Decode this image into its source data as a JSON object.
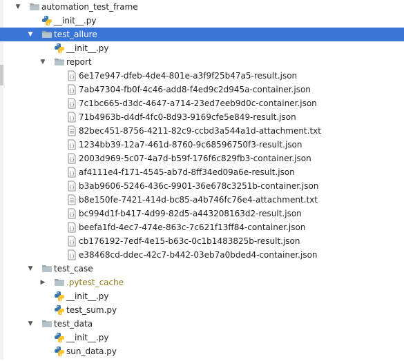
{
  "project_tree": {
    "nodes": [
      {
        "label": "automation_test_frame",
        "type": "folder",
        "level": 0,
        "expanded": true
      },
      {
        "label": "__init__.py",
        "type": "python",
        "level": 1
      },
      {
        "label": "test_allure",
        "type": "folder",
        "level": 1,
        "expanded": true,
        "selected": true
      },
      {
        "label": "__init__.py",
        "type": "python",
        "level": 2
      },
      {
        "label": "report",
        "type": "folder",
        "level": 2,
        "expanded": true
      },
      {
        "label": "6e17e947-dfeb-4de4-801e-a3f9f25b47a5-result.json",
        "type": "json",
        "level": 3
      },
      {
        "label": "7ab47304-fb0f-4c46-add8-f4ed9c2d945a-container.json",
        "type": "json",
        "level": 3
      },
      {
        "label": "7c1bc665-d3dc-4647-a714-23ed7eeb9d0c-container.json",
        "type": "json",
        "level": 3
      },
      {
        "label": "71b4963b-d4df-4fc0-8d93-9169cfe5e849-result.json",
        "type": "json",
        "level": 3
      },
      {
        "label": "82bec451-8756-4211-82c9-ccbd3a544a1d-attachment.txt",
        "type": "text",
        "level": 3
      },
      {
        "label": "1234bb39-12a7-461d-8760-9c68596750f3-result.json",
        "type": "json",
        "level": 3
      },
      {
        "label": "2003d969-5c07-4a7d-b59f-176f6c829fb3-container.json",
        "type": "json",
        "level": 3
      },
      {
        "label": "af4111e4-f171-4545-ab7d-8ff34ed09a6e-result.json",
        "type": "json",
        "level": 3
      },
      {
        "label": "b3ab9606-5246-436c-9901-36e678c3251b-container.json",
        "type": "json",
        "level": 3
      },
      {
        "label": "b8e150fe-7421-414d-bc85-a4b746fc76e4-attachment.txt",
        "type": "text",
        "level": 3
      },
      {
        "label": "bc994d1f-b417-4d99-82d5-a443208163d2-result.json",
        "type": "json",
        "level": 3
      },
      {
        "label": "beefa1fd-4ec7-474e-863c-7c621f13ff84-container.json",
        "type": "json",
        "level": 3
      },
      {
        "label": "cb176192-7edf-4e15-b63c-0c1b1483825b-result.json",
        "type": "json",
        "level": 3
      },
      {
        "label": "e38468cd-ddec-42c7-b442-03eb7a0bded4-container.json",
        "type": "json",
        "level": 3
      },
      {
        "label": "test_case",
        "type": "folder",
        "level": 1,
        "expanded": true
      },
      {
        "label": ".pytest_cache",
        "type": "folder",
        "level": 2,
        "expanded": false,
        "excluded": true
      },
      {
        "label": "__init__.py",
        "type": "python",
        "level": 2
      },
      {
        "label": "test_sum.py",
        "type": "python",
        "level": 2
      },
      {
        "label": "test_data",
        "type": "folder",
        "level": 1,
        "expanded": true
      },
      {
        "label": "__init__.py",
        "type": "python",
        "level": 2
      },
      {
        "label": "sun_data.py",
        "type": "python",
        "level": 2
      }
    ]
  },
  "colors": {
    "selection": "#3875d6",
    "folder": "#9aa7b0",
    "excluded_text": "#8a7a1c",
    "python_blue": "#3b77b0",
    "python_yellow": "#f4c431"
  },
  "icon_names": {
    "folder": "folder-icon",
    "python": "python-file-icon",
    "json": "json-file-icon",
    "text": "text-file-icon",
    "expanded": "chevron-down-icon",
    "collapsed": "chevron-right-icon"
  }
}
